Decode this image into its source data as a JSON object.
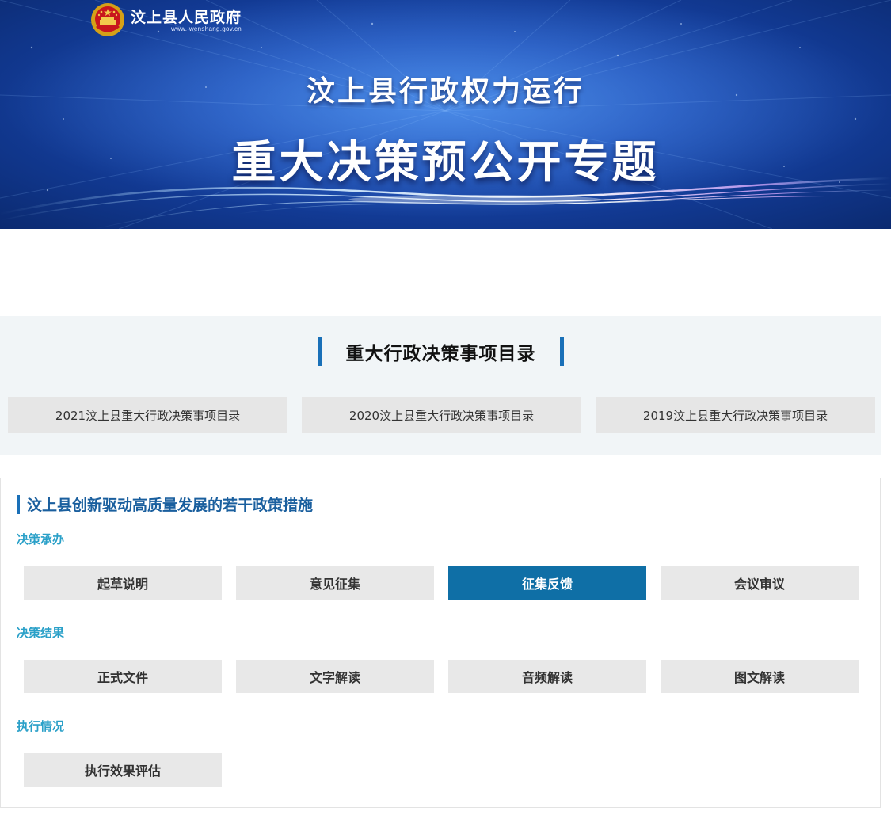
{
  "header": {
    "site_name": "汶上县人民政府",
    "site_url": "www. wenshang.gov.cn",
    "subtitle": "汶上县行政权力运行",
    "title": "重大决策预公开专题"
  },
  "catalog": {
    "title": "重大行政决策事项目录",
    "items": [
      {
        "label": "2021汶上县重大行政决策事项目录"
      },
      {
        "label": "2020汶上县重大行政决策事项目录"
      },
      {
        "label": "2019汶上县重大行政决策事项目录"
      }
    ]
  },
  "policy": {
    "title": "汶上县创新驱动高质量发展的若干政策措施",
    "groups": [
      {
        "label": "决策承办",
        "buttons": [
          {
            "label": "起草说明",
            "active": false
          },
          {
            "label": "意见征集",
            "active": false
          },
          {
            "label": "征集反馈",
            "active": true
          },
          {
            "label": "会议审议",
            "active": false
          }
        ]
      },
      {
        "label": "决策结果",
        "buttons": [
          {
            "label": "正式文件",
            "active": false
          },
          {
            "label": "文字解读",
            "active": false
          },
          {
            "label": "音频解读",
            "active": false
          },
          {
            "label": "图文解读",
            "active": false
          }
        ]
      },
      {
        "label": "执行情况",
        "buttons": [
          {
            "label": "执行效果评估",
            "active": false
          }
        ]
      }
    ]
  },
  "colors": {
    "accent_blue": "#1a70b8",
    "active_button": "#0f6fa6",
    "group_label": "#2aa0c8",
    "policy_title": "#1a5f9e"
  }
}
